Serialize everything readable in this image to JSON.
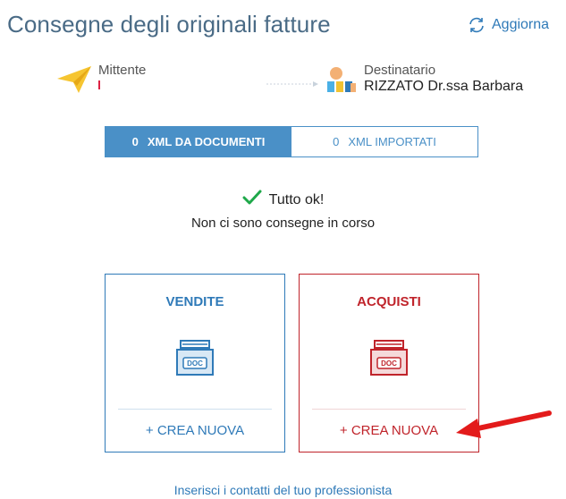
{
  "header": {
    "title": "Consegne degli originali fatture",
    "refresh_label": "Aggiorna"
  },
  "flow": {
    "sender_label": "Mittente",
    "recipient_label": "Destinatario",
    "recipient_value": "RIZZATO Dr.ssa Barbara"
  },
  "tabs": [
    {
      "count": "0",
      "label": "XML DA DOCUMENTI",
      "active": true
    },
    {
      "count": "0",
      "label": "XML IMPORTATI",
      "active": false
    }
  ],
  "status": {
    "ok_text": "Tutto ok!",
    "detail_text": "Non ci sono consegne in corso"
  },
  "cards": {
    "sales": {
      "title": "VENDITE",
      "create_label": "+ CREA NUOVA",
      "icon_text": "DOC"
    },
    "purchases": {
      "title": "ACQUISTI",
      "create_label": "+ CREA NUOVA",
      "icon_text": "DOC"
    }
  },
  "footer": {
    "link_text": "Inserisci i contatti del tuo professionista"
  },
  "colors": {
    "accent_blue": "#2f7ab8",
    "accent_red": "#c0242b",
    "success_green": "#1fa84a"
  },
  "icons": [
    "refresh-icon",
    "paper-plane-icon",
    "dotted-arrow-icon",
    "people-icon",
    "checkmark-icon",
    "doc-archive-icon",
    "red-annotation-arrow"
  ]
}
